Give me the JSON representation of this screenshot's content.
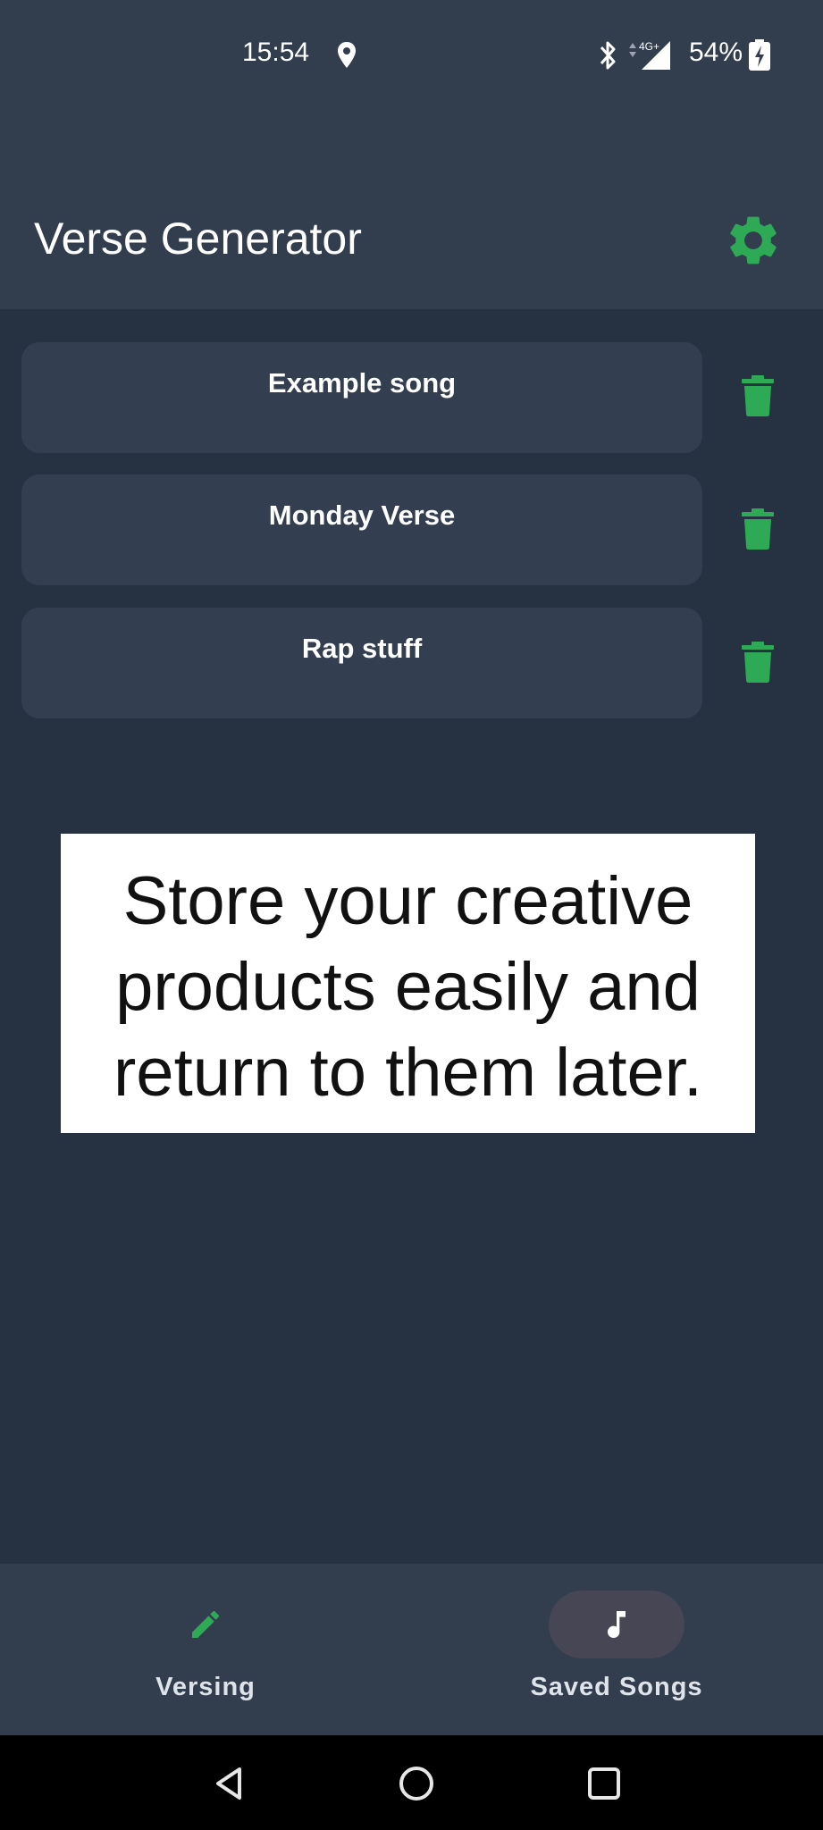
{
  "status_bar": {
    "time": "15:54",
    "network": "4G+",
    "battery": "54%"
  },
  "header": {
    "title": "Verse Generator",
    "settings_icon": "gear-icon"
  },
  "songs": [
    {
      "title": "Example song"
    },
    {
      "title": "Monday Verse"
    },
    {
      "title": "Rap stuff"
    }
  ],
  "promo": {
    "lines": [
      "Store your creative",
      "products easily and",
      "return to them later."
    ]
  },
  "bottom_nav": {
    "items": [
      {
        "label": "Versing",
        "icon": "pencil-icon",
        "active": false
      },
      {
        "label": "Saved Songs",
        "icon": "music-note-icon",
        "active": true
      }
    ]
  },
  "colors": {
    "accent": "#2eaa57",
    "header_bg": "#323e4e",
    "content_bg": "#263241",
    "card_bg": "#333f50",
    "active_pill": "#474655"
  }
}
